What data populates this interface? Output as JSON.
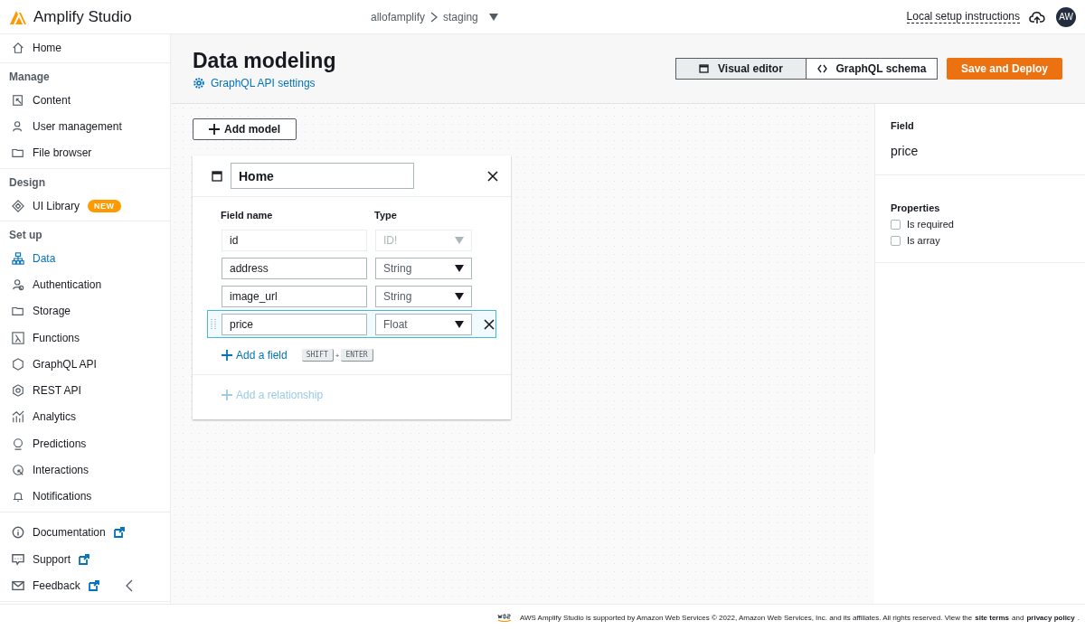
{
  "top_bar": {
    "app_name": "Amplify Studio",
    "breadcrumb": [
      "allofamplify",
      "staging"
    ],
    "setup_link": "Local setup instructions",
    "avatar": "AW"
  },
  "sidebar": {
    "home": {
      "label": "Home",
      "selected": false
    },
    "sections": [
      {
        "heading": "Manage",
        "items": [
          {
            "label": "Content",
            "selected": false
          },
          {
            "label": "User management",
            "selected": false
          },
          {
            "label": "File browser",
            "selected": false
          }
        ]
      },
      {
        "heading": "Design",
        "items": [
          {
            "label": "UI Library",
            "selected": false,
            "badge": "NEW"
          }
        ]
      },
      {
        "heading": "Set up",
        "items": [
          {
            "label": "Data",
            "selected": true
          },
          {
            "label": "Authentication",
            "selected": false
          },
          {
            "label": "Storage",
            "selected": false
          },
          {
            "label": "Functions",
            "selected": false
          },
          {
            "label": "GraphQL API",
            "selected": false
          },
          {
            "label": "REST API",
            "selected": false
          },
          {
            "label": "Analytics",
            "selected": false
          },
          {
            "label": "Predictions",
            "selected": false
          },
          {
            "label": "Interactions",
            "selected": false
          },
          {
            "label": "Notifications",
            "selected": false
          }
        ]
      }
    ],
    "links": [
      {
        "label": "Documentation",
        "external": true
      },
      {
        "label": "Support",
        "external": true
      },
      {
        "label": "Feedback",
        "external": true
      }
    ]
  },
  "header": {
    "title": "Data modeling",
    "settings_link": "GraphQL API settings",
    "view_toggle": [
      {
        "label": "Visual editor",
        "selected": true
      },
      {
        "label": "GraphQL schema",
        "selected": false
      }
    ],
    "deploy_button": "Save and Deploy"
  },
  "canvas": {
    "add_model_button": "Add model",
    "model": {
      "name": "Home",
      "columns": [
        "Field name",
        "Type"
      ],
      "fields": [
        {
          "name": "id",
          "type": "ID!",
          "disabled": true,
          "selected": false
        },
        {
          "name": "address",
          "type": "String",
          "disabled": false,
          "selected": false
        },
        {
          "name": "image_url",
          "type": "String",
          "disabled": false,
          "selected": false
        },
        {
          "name": "price",
          "type": "Float",
          "disabled": false,
          "selected": true
        }
      ],
      "add_field": "Add a field",
      "shortcut": {
        "keys": [
          "SHIFT",
          "ENTER"
        ],
        "joiner": "+"
      },
      "add_relationship": {
        "label": "Add a relationship",
        "disabled": true
      }
    }
  },
  "field_panel": {
    "heading": "Field",
    "value": "price",
    "properties_heading": "Properties",
    "options": [
      {
        "label": "Is required",
        "checked": false
      },
      {
        "label": "Is array",
        "checked": false
      }
    ]
  },
  "footer": [
    {
      "kind": "text",
      "text": "AWS Amplify Studio is supported by Amazon Web Services © 2022, Amazon Web Services, Inc. and its affiliates. All rights reserved. View the"
    },
    {
      "kind": "link",
      "text": "site terms"
    },
    {
      "kind": "text",
      "text": "and"
    },
    {
      "kind": "link",
      "text": "privacy policy"
    },
    {
      "kind": "text",
      "text": "."
    }
  ]
}
